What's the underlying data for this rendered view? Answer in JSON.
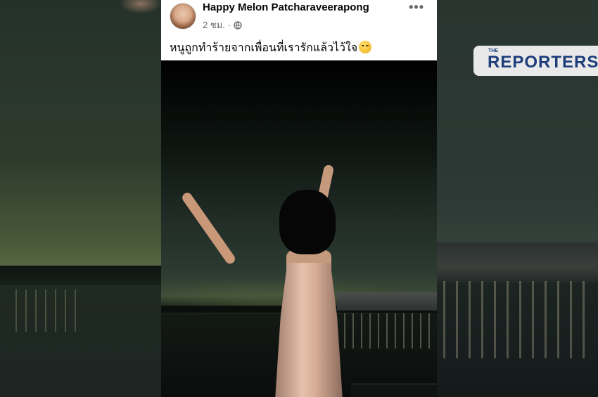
{
  "post": {
    "author": "Happy Melon Patcharaveerapong",
    "time": "2 ชม.",
    "separator": "·",
    "privacy_icon": "globe-icon",
    "more_label": "•••",
    "caption": "หนูถูกทำร้ายจากเพื่อนที่เรารักแล้วไว้ใจ",
    "caption_emoji": "worried-face-emoji"
  },
  "watermark": {
    "small": "THE",
    "brand": "REPORTERS",
    "color": "#1d3e7a"
  }
}
